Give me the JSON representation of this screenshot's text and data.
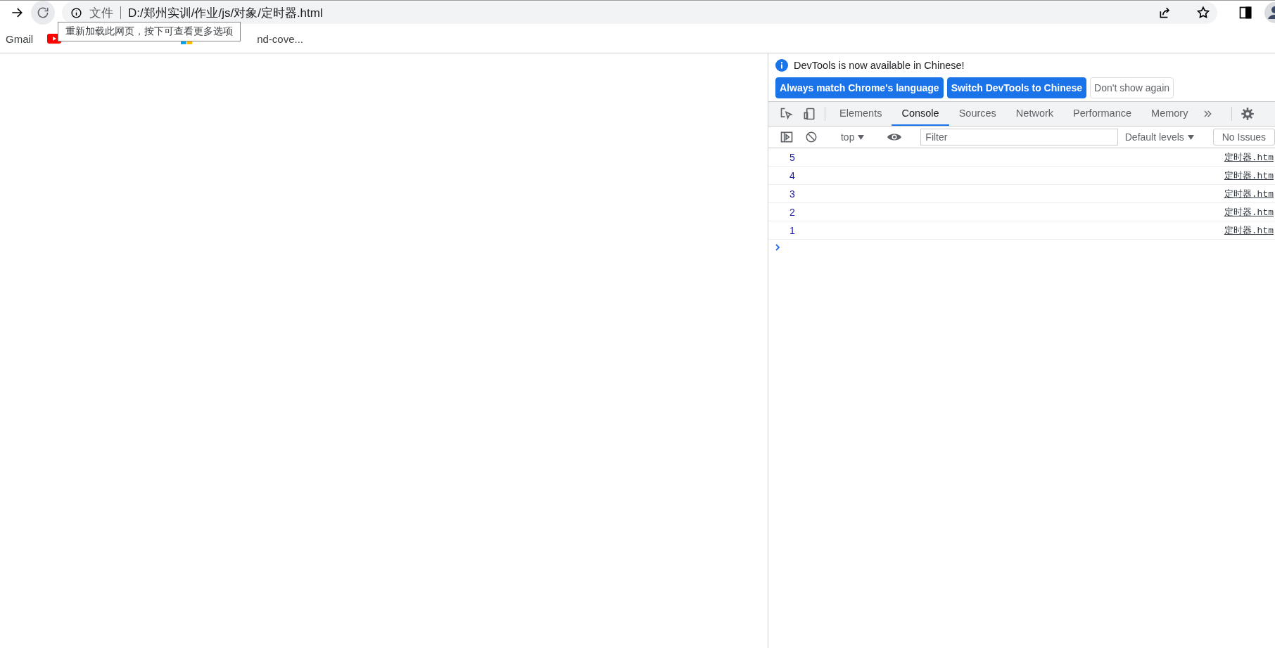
{
  "browser": {
    "address": {
      "scheme_label": "文件",
      "url": "D:/郑州实训/作业/js/对象/定时器.html"
    },
    "tooltip": "重新加载此网页，按下可查看更多选项",
    "bookmarks": [
      {
        "kind": "text",
        "label": "Gmail"
      },
      {
        "kind": "youtube"
      },
      {
        "kind": "windows",
        "label": "nd-cove..."
      }
    ]
  },
  "devtools": {
    "notice": {
      "message": "DevTools is now available in Chinese!",
      "buttons": [
        {
          "label": "Always match Chrome's language",
          "kind": "primary"
        },
        {
          "label": "Switch DevTools to Chinese",
          "kind": "primary"
        },
        {
          "label": "Don't show again",
          "kind": "secondary"
        }
      ]
    },
    "tabs": [
      {
        "label": "Elements",
        "selected": false
      },
      {
        "label": "Console",
        "selected": true
      },
      {
        "label": "Sources",
        "selected": false
      },
      {
        "label": "Network",
        "selected": false
      },
      {
        "label": "Performance",
        "selected": false
      },
      {
        "label": "Memory",
        "selected": false
      }
    ],
    "console_toolbar": {
      "context": "top",
      "filter": {
        "placeholder": "Filter"
      },
      "levels": "Default levels",
      "issues": "No Issues"
    },
    "messages": [
      {
        "value": "5",
        "source": "定时器.htm"
      },
      {
        "value": "4",
        "source": "定时器.htm"
      },
      {
        "value": "3",
        "source": "定时器.htm"
      },
      {
        "value": "2",
        "source": "定时器.htm"
      },
      {
        "value": "1",
        "source": "定时器.htm"
      }
    ]
  }
}
